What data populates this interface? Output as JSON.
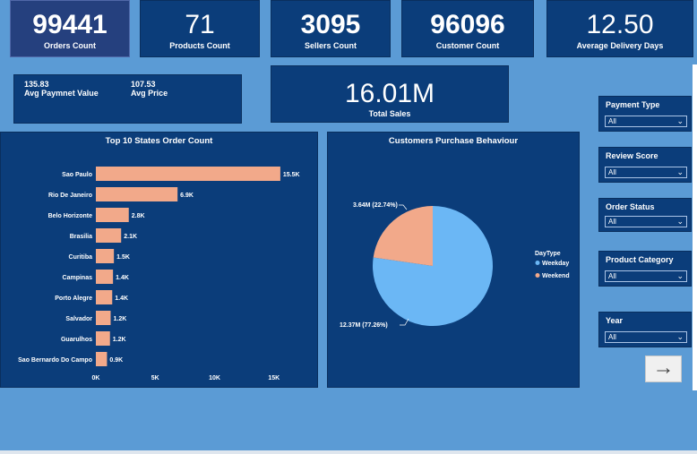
{
  "kpis": [
    {
      "value": "99441",
      "label": "Orders Count"
    },
    {
      "value": "71",
      "label": "Products Count"
    },
    {
      "value": "3095",
      "label": "Sellers Count"
    },
    {
      "value": "96096",
      "label": "Customer Count"
    },
    {
      "value": "12.50",
      "label": "Average Delivery Days"
    }
  ],
  "mini": {
    "avg_payment_value": "135.83",
    "avg_payment_label": "Avg Paymnet Value",
    "avg_price_value": "107.53",
    "avg_price_label": "Avg Price"
  },
  "total_sales": {
    "value": "16.01M",
    "label": "Total Sales"
  },
  "slicers": [
    {
      "title": "Payment Type",
      "value": "All"
    },
    {
      "title": "Review Score",
      "value": "All"
    },
    {
      "title": "Order Status",
      "value": "All"
    },
    {
      "title": "Product Category",
      "value": "All"
    },
    {
      "title": "Year",
      "value": "All"
    }
  ],
  "nav": {
    "arrow_glyph": "→"
  },
  "colors": {
    "panel": "#0b3d7a",
    "bar": "#f2a98a",
    "weekday": "#6bb7f5",
    "weekend": "#f2a98a",
    "background": "#5b9bd5"
  },
  "chart_data": [
    {
      "type": "bar",
      "orientation": "horizontal",
      "title": "Top 10 States Order Count",
      "categories": [
        "Sao Paulo",
        "Rio De Janeiro",
        "Belo Horizonte",
        "Brasilia",
        "Curitiba",
        "Campinas",
        "Porto Alegre",
        "Salvador",
        "Guarulhos",
        "Sao Bernardo Do Campo"
      ],
      "values": [
        15540,
        6882,
        2773,
        2131,
        1521,
        1444,
        1379,
        1245,
        1189,
        938
      ],
      "data_labels": [
        "15.5K",
        "6.9K",
        "2.8K",
        "2.1K",
        "1.5K",
        "1.4K",
        "1.4K",
        "1.2K",
        "1.2K",
        "0.9K"
      ],
      "xticks": [
        "0K",
        "5K",
        "10K",
        "15K"
      ],
      "xlim": [
        0,
        16000
      ],
      "grid": false
    },
    {
      "type": "pie",
      "title": "Customers Purchase Behaviour",
      "legend_title": "DayType",
      "legend_position": "right",
      "slices": [
        {
          "name": "Weekday",
          "value": 12.37,
          "label": "12.37M (77.26%)"
        },
        {
          "name": "Weekend",
          "value": 3.64,
          "label": "3.64M (22.74%)"
        }
      ]
    }
  ]
}
